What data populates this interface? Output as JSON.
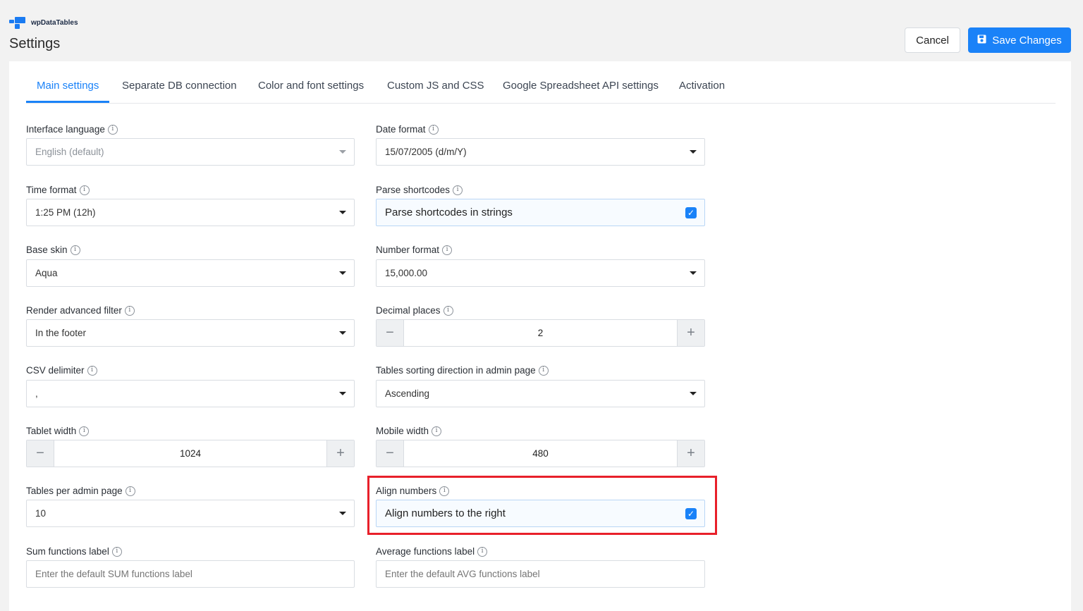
{
  "brand": {
    "name": "wpDataTables",
    "logo_color": "#1a7bf2"
  },
  "header": {
    "title": "Settings",
    "cancel_label": "Cancel",
    "save_label": "Save Changes",
    "accent_color": "#1a82f8"
  },
  "tabs": [
    {
      "label": "Main settings",
      "active": true
    },
    {
      "label": "Separate DB connection",
      "active": false
    },
    {
      "label": "Color and font settings",
      "active": false
    },
    {
      "label": "Custom JS and CSS",
      "active": false
    },
    {
      "label": "Google Spreadsheet API settings",
      "active": false
    },
    {
      "label": "Activation",
      "active": false
    }
  ],
  "info_glyph": "i",
  "fields": {
    "interface_language": {
      "label": "Interface language",
      "value": "English (default)",
      "disabled": true
    },
    "date_format": {
      "label": "Date format",
      "value": "15/07/2005 (d/m/Y)"
    },
    "time_format": {
      "label": "Time format",
      "value": "1:25 PM (12h)"
    },
    "parse_shortcodes": {
      "label": "Parse shortcodes",
      "option": "Parse shortcodes in strings",
      "checked": true
    },
    "base_skin": {
      "label": "Base skin",
      "value": "Aqua"
    },
    "number_format": {
      "label": "Number format",
      "value": "15,000.00"
    },
    "render_advanced_filter": {
      "label": "Render advanced filter",
      "value": "In the footer"
    },
    "decimal_places": {
      "label": "Decimal places",
      "value": "2"
    },
    "csv_delimiter": {
      "label": "CSV delimiter",
      "value": ","
    },
    "tables_sorting": {
      "label": "Tables sorting direction in admin page",
      "value": "Ascending"
    },
    "tablet_width": {
      "label": "Tablet width",
      "value": "1024"
    },
    "mobile_width": {
      "label": "Mobile width",
      "value": "480"
    },
    "tables_per_page": {
      "label": "Tables per admin page",
      "value": "10"
    },
    "align_numbers": {
      "label": "Align numbers",
      "option": "Align numbers to the right",
      "checked": true
    },
    "sum_label": {
      "label": "Sum functions label",
      "placeholder": "Enter the default SUM functions label"
    },
    "avg_label": {
      "label": "Average functions label",
      "placeholder": "Enter the default AVG functions label"
    }
  },
  "stepper": {
    "minus": "−",
    "plus": "+"
  },
  "highlight_color": "#e8202a"
}
